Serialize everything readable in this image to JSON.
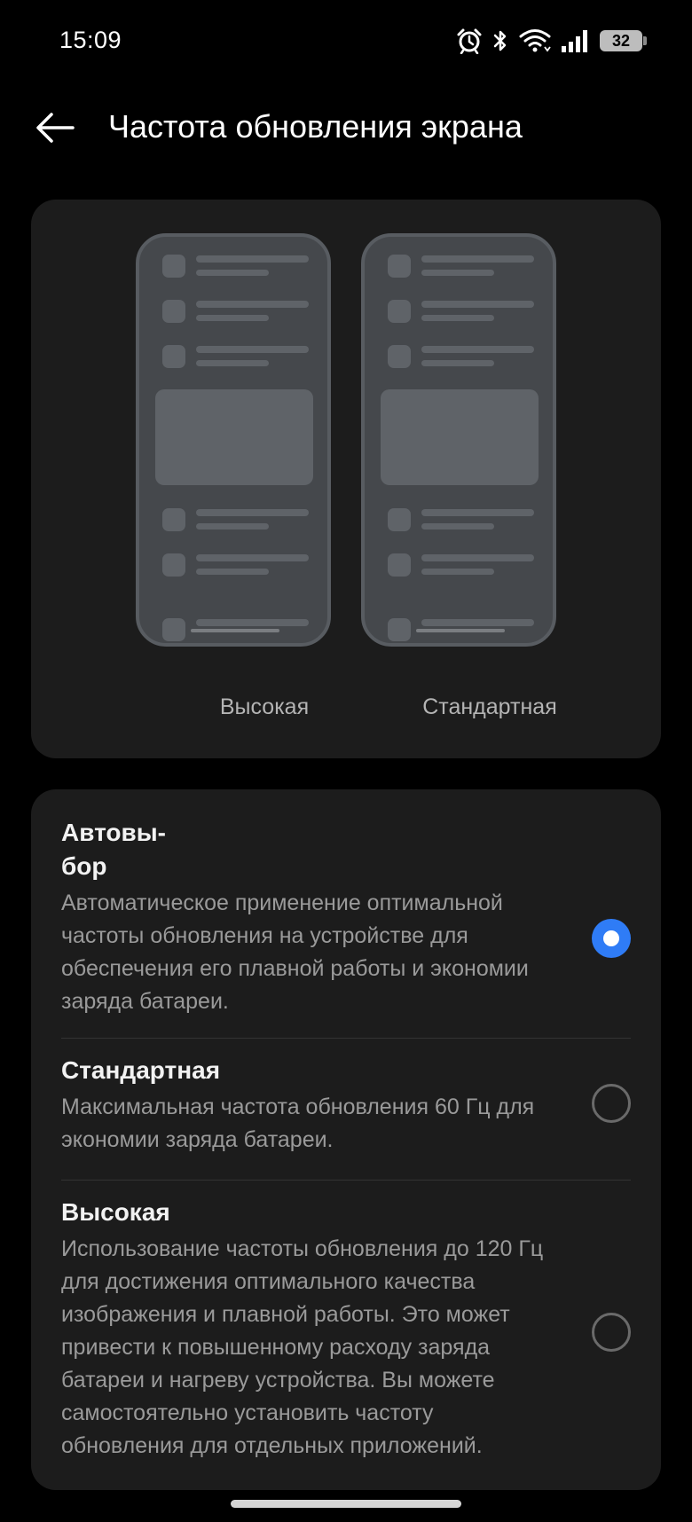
{
  "status_bar": {
    "time": "15:09",
    "battery_level": "32",
    "icons": [
      "alarm-icon",
      "bluetooth-icon",
      "wifi-icon",
      "signal-icon",
      "battery-icon"
    ]
  },
  "header": {
    "back_icon": "arrow-left-icon",
    "title": "Частота обновления экрана"
  },
  "preview": {
    "left_label": "Высокая",
    "right_label": "Стандартная"
  },
  "options": [
    {
      "title": "Автовы-\nбор",
      "description": "Автоматическое применение оптимальной частоты обновления на устройстве для обеспечения его плавной работы и экономии заряда батареи.",
      "selected": true
    },
    {
      "title": "Стандартная",
      "description": "Максимальная частота обновления 60 Гц для экономии заряда батареи.",
      "selected": false
    },
    {
      "title": "Высокая",
      "description": "Использование частоты обновления до 120 Гц для достижения оптимального качества изображения и плавной работы. Это может привести к повышенному расходу заряда батареи и нагреву устройства. Вы можете самостоятельно установить частоту обновления для отдельных приложений.",
      "selected": false
    }
  ],
  "colors": {
    "background": "#000000",
    "card": "#1c1c1c",
    "accent": "#2f7cf6",
    "secondary_text": "#9a9a9a"
  }
}
